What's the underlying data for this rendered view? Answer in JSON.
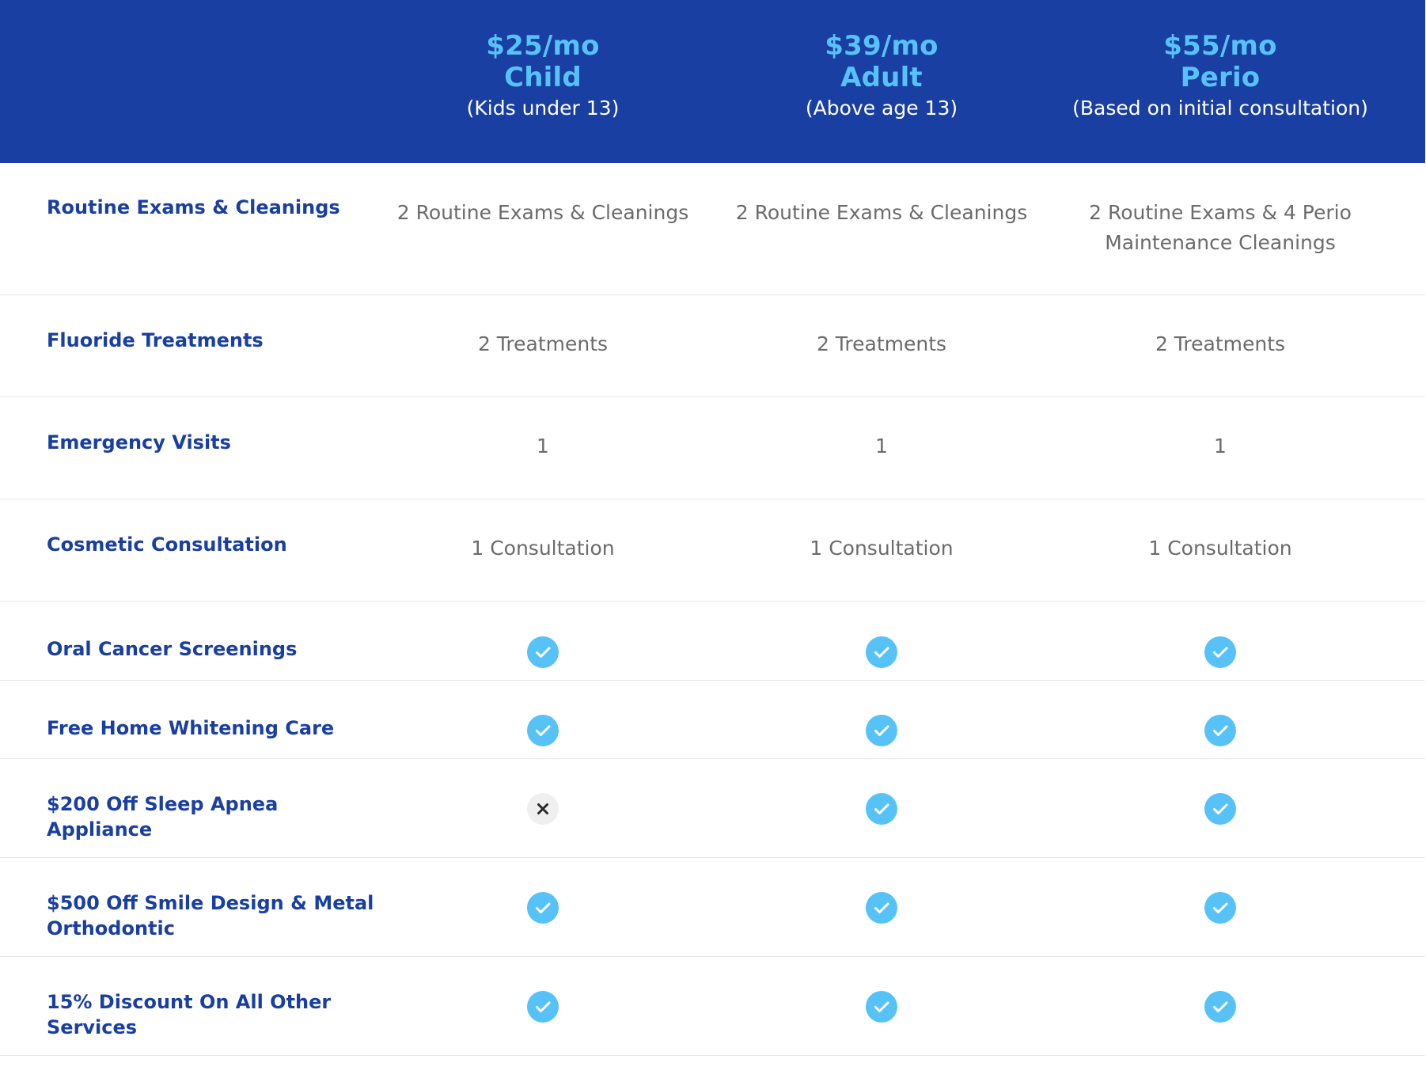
{
  "plans": [
    {
      "price": "$25/mo",
      "name": "Child",
      "subtitle": "(Kids under 13)"
    },
    {
      "price": "$39/mo",
      "name": "Adult",
      "subtitle": "(Above age 13)"
    },
    {
      "price": "$55/mo",
      "name": "Perio",
      "subtitle": "(Based on initial consultation)"
    }
  ],
  "rows": [
    {
      "label": "Routine Exams & Cleanings",
      "values": [
        "2 Routine Exams & Cleanings",
        "2 Routine Exams & Cleanings",
        "2 Routine Exams & 4 Perio Maintenance Cleanings"
      ]
    },
    {
      "label": "Fluoride Treatments",
      "values": [
        "2 Treatments",
        "2 Treatments",
        "2 Treatments"
      ]
    },
    {
      "label": "Emergency Visits",
      "values": [
        "1",
        "1",
        "1"
      ]
    },
    {
      "label": "Cosmetic Consultation",
      "values": [
        "1 Consultation",
        "1 Consultation",
        "1 Consultation"
      ]
    },
    {
      "label": "Oral Cancer Screenings",
      "icons": [
        "check-icon",
        "check-icon",
        "check-icon"
      ]
    },
    {
      "label": "Free Home Whitening Care",
      "icons": [
        "check-icon",
        "check-icon",
        "check-icon"
      ]
    },
    {
      "label": "$200 Off Sleep Apnea Appliance",
      "icons": [
        "x-icon",
        "check-icon",
        "check-icon"
      ]
    },
    {
      "label": "$500 Off Smile Design & Metal Orthodontic",
      "icons": [
        "check-icon",
        "check-icon",
        "check-icon"
      ]
    },
    {
      "label": "15% Discount On All Other Services",
      "icons": [
        "check-icon",
        "check-icon",
        "check-icon"
      ]
    }
  ],
  "colors": {
    "header_bg": "#1a3fa2",
    "accent": "#57c2f8",
    "label_text": "#1a3fa2",
    "value_text": "#6b6b6b",
    "divider": "#e7e7ea",
    "check_bg": "#57c2f8",
    "x_bg": "#efefef"
  }
}
